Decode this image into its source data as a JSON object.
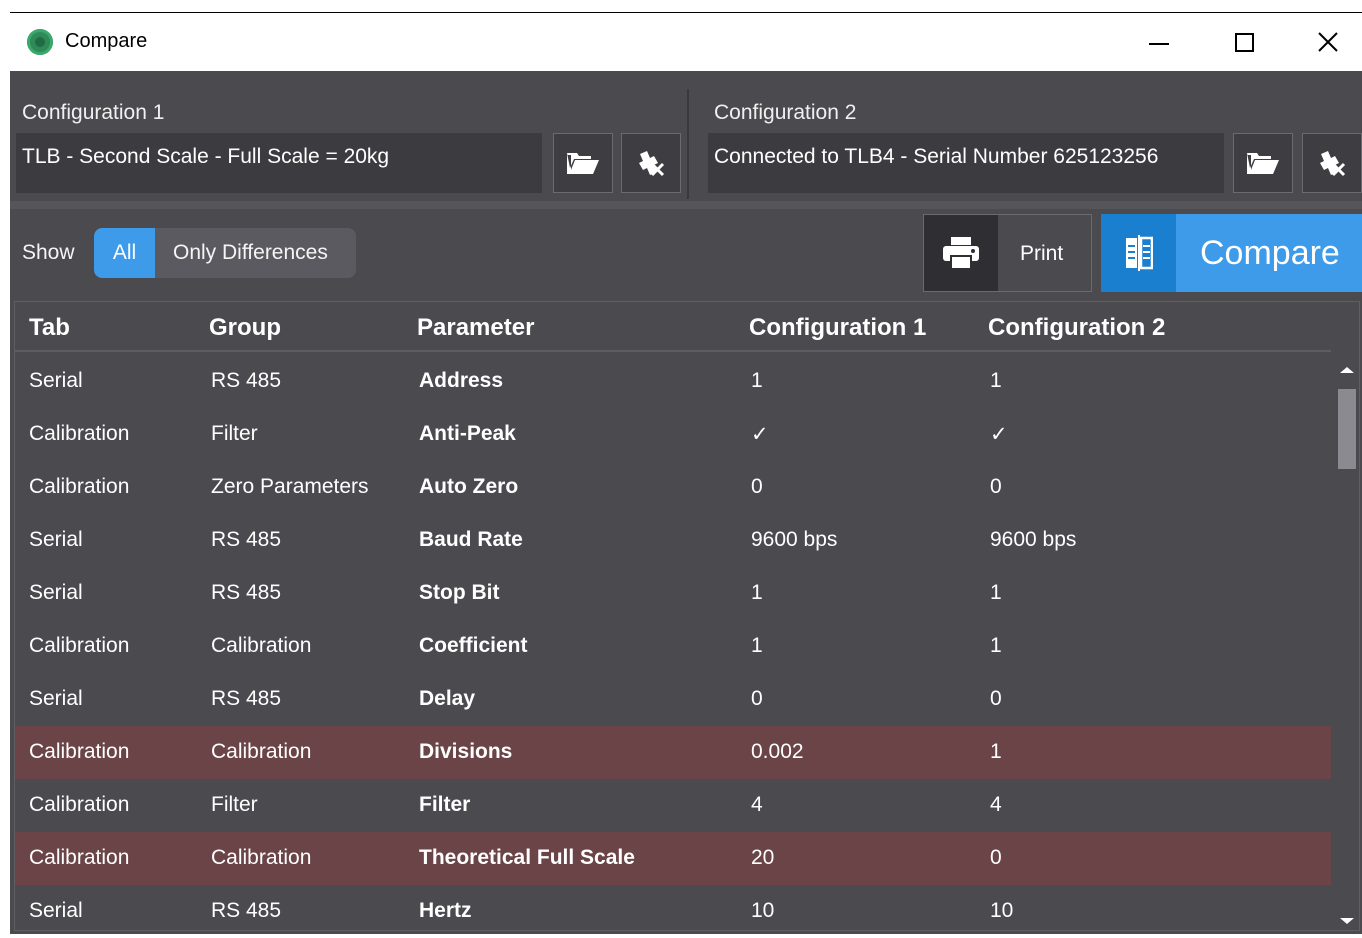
{
  "window": {
    "title": "Compare",
    "minimize_icon": "minimize-icon",
    "maximize_icon": "maximize-icon",
    "close_icon": "close-icon"
  },
  "config1": {
    "label": "Configuration 1",
    "value": "TLB - Second Scale - Full Scale = 20kg",
    "open_icon": "folder-open-icon",
    "connect_icon": "plug-connect-icon"
  },
  "config2": {
    "label": "Configuration 2",
    "value": "Connected to TLB4 - Serial Number 625123256",
    "open_icon": "folder-open-icon",
    "connect_icon": "plug-connect-icon"
  },
  "show": {
    "label": "Show",
    "options": [
      "All",
      "Only Differences"
    ],
    "selected": "All"
  },
  "actions": {
    "print_label": "Print",
    "compare_label": "Compare"
  },
  "colors": {
    "accent": "#3d9be9",
    "accent_dark": "#1b7fd0",
    "background": "#4a4a4f",
    "difference_row": "#6a4446"
  },
  "table": {
    "columns": [
      "Tab",
      "Group",
      "Parameter",
      "Configuration 1",
      "Configuration 2"
    ],
    "rows": [
      {
        "tab": "Serial",
        "group": "RS 485",
        "parameter": "Address",
        "c1": "1",
        "c2": "1",
        "diff": false
      },
      {
        "tab": "Calibration",
        "group": "Filter",
        "parameter": "Anti-Peak",
        "c1": "✓",
        "c2": "✓",
        "diff": false
      },
      {
        "tab": "Calibration",
        "group": "Zero Parameters",
        "parameter": "Auto Zero",
        "c1": "0",
        "c2": "0",
        "diff": false
      },
      {
        "tab": "Serial",
        "group": "RS 485",
        "parameter": "Baud Rate",
        "c1": "9600 bps",
        "c2": "9600 bps",
        "diff": false
      },
      {
        "tab": "Serial",
        "group": "RS 485",
        "parameter": "Stop Bit",
        "c1": "1",
        "c2": "1",
        "diff": false
      },
      {
        "tab": "Calibration",
        "group": "Calibration",
        "parameter": "Coefficient",
        "c1": "1",
        "c2": "1",
        "diff": false
      },
      {
        "tab": "Serial",
        "group": "RS 485",
        "parameter": "Delay",
        "c1": "0",
        "c2": "0",
        "diff": false
      },
      {
        "tab": "Calibration",
        "group": "Calibration",
        "parameter": "Divisions",
        "c1": "0.002",
        "c2": "1",
        "diff": true
      },
      {
        "tab": "Calibration",
        "group": "Filter",
        "parameter": "Filter",
        "c1": "4",
        "c2": "4",
        "diff": false
      },
      {
        "tab": "Calibration",
        "group": "Calibration",
        "parameter": "Theoretical Full Scale",
        "c1": "20",
        "c2": "0",
        "diff": true
      },
      {
        "tab": "Serial",
        "group": "RS 485",
        "parameter": "Hertz",
        "c1": "10",
        "c2": "10",
        "diff": false
      }
    ]
  }
}
